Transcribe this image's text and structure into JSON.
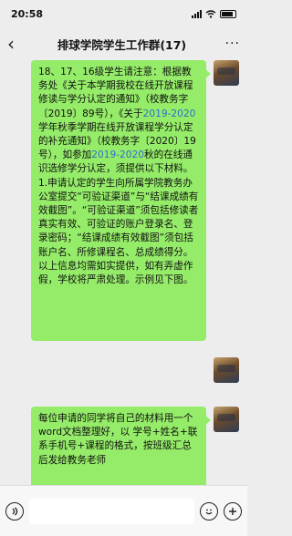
{
  "status_bar": {
    "time": "20:58"
  },
  "header": {
    "title": "排球学院学生工作群(17)"
  },
  "messages": [
    {
      "parts": [
        "18、17、16级学生请注意：根据教务处《关于本学期我校在线开放课程修读与学分认定的通知》（校教务字〔2019〕89号），《关于",
        "2019-2020",
        "学年秋季学期在线开放课程学分认定的补充通知》（校教务字〔2020〕19号），如参加",
        "2019-2020",
        "秋的在线通识选修学分认定，须提供以下材料。\n1.申请认定的学生向所属学院教务办公室提交“可验证渠道”与“结课成绩有效截图”。“可验证渠道”须包括修读者真实有效、可验证的账户登录名、登录密码；“结课成绩有效截图”须包括账户名、所修课程名、总成绩得分。以上信息均需如实提供，如有弄虚作假，学校将严肃处理。示例见下图。"
      ]
    },
    {
      "text": "每位申请的同学将自己的材料用一个word文档整理好，以 学号+姓名+联系手机号+课程的格式，按班级汇总后发给教务老师"
    }
  ],
  "icons": {
    "back": "back-arrow-icon",
    "more": "more-icon",
    "voice": "voice-icon",
    "emoji": "emoji-icon",
    "plus": "plus-icon"
  }
}
